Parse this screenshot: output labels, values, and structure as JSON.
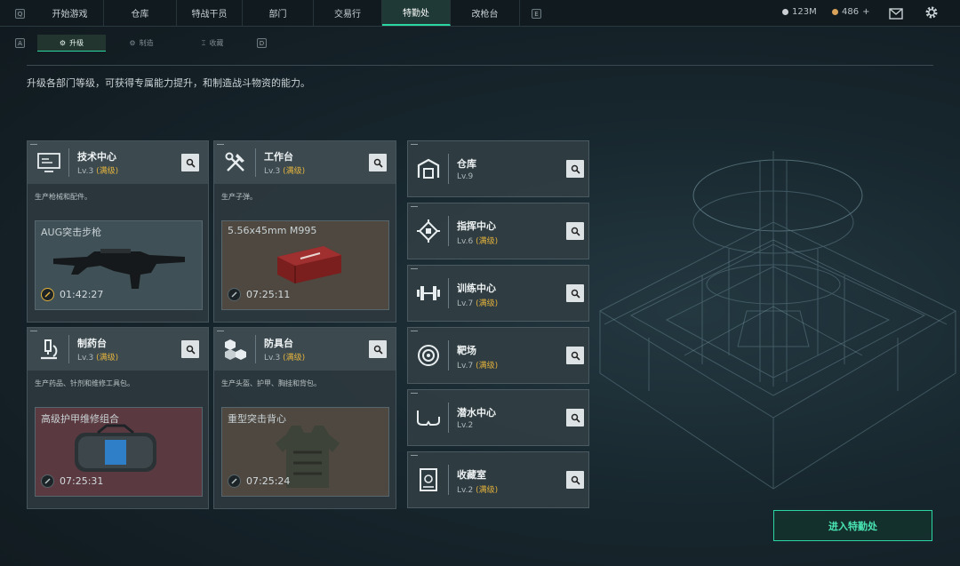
{
  "nav": {
    "left_key": "Q",
    "right_key": "E",
    "tabs": [
      {
        "label": "开始游戏"
      },
      {
        "label": "仓库"
      },
      {
        "label": "特战干员"
      },
      {
        "label": "部门"
      },
      {
        "label": "交易行"
      },
      {
        "label": "特勤处"
      },
      {
        "label": "改枪台"
      }
    ],
    "active_tab": "特勤处"
  },
  "resources": {
    "currency_value": "123M",
    "coin_value": "486",
    "coin_add": "+"
  },
  "subnav": {
    "left_key": "A",
    "right_key": "D",
    "tabs": [
      {
        "label": "升级"
      },
      {
        "label": "制造"
      },
      {
        "label": "收藏"
      }
    ]
  },
  "description": "升级各部门等级，可获得专属能力提升，和制造战斗物资的能力。",
  "max_tag": "(满级)",
  "big_cards": [
    {
      "title": "技术中心",
      "level": "Lv.3",
      "desc": "生产枪械和配件。",
      "item": "AUG突击步枪",
      "timer": "01:42:27"
    },
    {
      "title": "工作台",
      "level": "Lv.3",
      "desc": "生产子弹。",
      "item": "5.56x45mm M995",
      "timer": "07:25:11"
    },
    {
      "title": "制药台",
      "level": "Lv.3",
      "desc": "生产药品、针剂和维修工具包。",
      "item": "高级护甲维修组合",
      "timer": "07:25:31"
    },
    {
      "title": "防具台",
      "level": "Lv.3",
      "desc": "生产头盔、护甲、胸挂和背包。",
      "item": "重型突击背心",
      "timer": "07:25:24"
    }
  ],
  "small_cards": [
    {
      "title": "仓库",
      "level": "Lv.9",
      "max": false
    },
    {
      "title": "指挥中心",
      "level": "Lv.6",
      "max": true
    },
    {
      "title": "训练中心",
      "level": "Lv.7",
      "max": true
    },
    {
      "title": "靶场",
      "level": "Lv.7",
      "max": true
    },
    {
      "title": "潜水中心",
      "level": "Lv.2",
      "max": false
    },
    {
      "title": "收藏室",
      "level": "Lv.2",
      "max": true
    }
  ],
  "enter_button": "进入特勤处",
  "colors": {
    "accent": "#2bd6a2",
    "max_level": "#e3b23c",
    "bg": "#17262d"
  }
}
